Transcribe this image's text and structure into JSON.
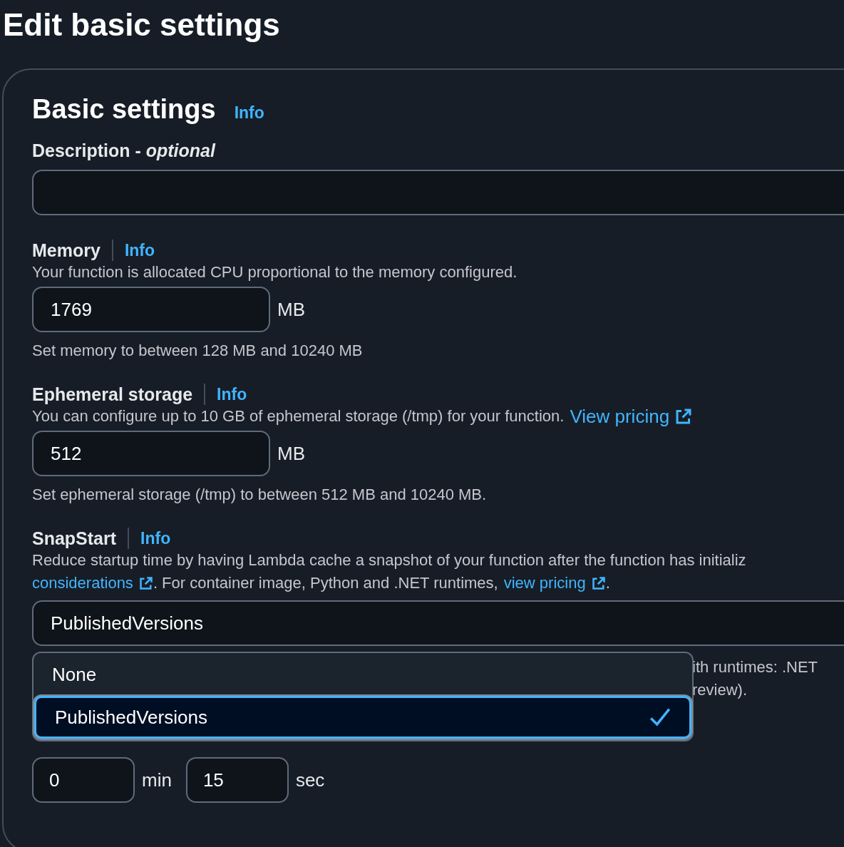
{
  "title": "Edit basic settings",
  "section": {
    "heading": "Basic settings",
    "info": "Info"
  },
  "description": {
    "label": "Description - *optional*"
  },
  "memory": {
    "label": "Memory",
    "info": "Info",
    "hint": "Your function is allocated CPU proportional to the memory configured.",
    "value": "1769",
    "unit": "MB",
    "constraint": "Set memory to between 128 MB and 10240 MB"
  },
  "ephemeral": {
    "label": "Ephemeral storage",
    "info": "Info",
    "hint": "You can configure up to 10 GB of ephemeral storage (/tmp) for your function.",
    "link": "View pricing",
    "value": "512",
    "unit": "MB",
    "constraint": "Set ephemeral storage (/tmp) to between 512 MB and 10240 MB."
  },
  "snapstart": {
    "label": "SnapStart",
    "info": "Info",
    "hint": "Reduce startup time by having Lambda cache a snapshot of your function after the function has initializ",
    "link1": "considerations",
    "hint2": ". For container image, Python and .NET runtimes,",
    "link2": "view pricing",
    "hint_end": ".",
    "value": "PublishedVersions",
    "options": [
      {
        "label": "None",
        "selected": false
      },
      {
        "label": "PublishedVersions",
        "selected": true
      }
    ],
    "notes": [
      "ith runtimes: .NET",
      "review)."
    ]
  },
  "timeout": {
    "min_value": "0",
    "min_unit": "min",
    "sec_value": "15",
    "sec_unit": "sec"
  }
}
